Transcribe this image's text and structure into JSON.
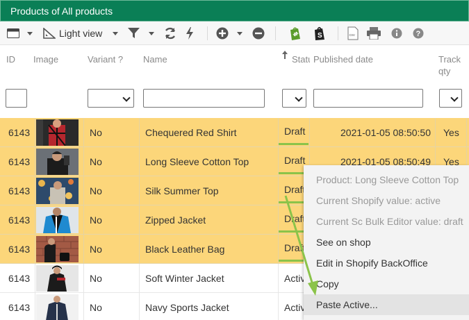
{
  "title": "Products of All products",
  "toolbar": {
    "view_label": "Light view"
  },
  "columns": {
    "id": "ID",
    "image": "Image",
    "variant": "Variant ?",
    "name": "Name",
    "status": "Statu",
    "published": "Published date",
    "track_line1": "Track",
    "track_line2": "qty"
  },
  "rows": [
    {
      "id": "6143",
      "variant": "No",
      "name": "Chequered Red Shirt",
      "status": "Draft",
      "published": "2021-01-05 08:50:50",
      "track": "Yes",
      "selected": true
    },
    {
      "id": "6143",
      "variant": "No",
      "name": "Long Sleeve Cotton Top",
      "status": "Draft",
      "published": "2021-01-05 08:50:49",
      "track": "Yes",
      "selected": true
    },
    {
      "id": "6143",
      "variant": "No",
      "name": "Silk Summer Top",
      "status": "Draft",
      "published": "",
      "track": "",
      "selected": true
    },
    {
      "id": "6143",
      "variant": "No",
      "name": "Zipped Jacket",
      "status": "Draft",
      "published": "",
      "track": "",
      "selected": true
    },
    {
      "id": "6143",
      "variant": "No",
      "name": "Black Leather Bag",
      "status": "Draft",
      "published": "",
      "track": "",
      "selected": true
    },
    {
      "id": "6143",
      "variant": "No",
      "name": "Soft Winter Jacket",
      "status": "Active",
      "published": "",
      "track": "",
      "selected": false
    },
    {
      "id": "6143",
      "variant": "No",
      "name": "Navy Sports Jacket",
      "status": "Active",
      "published": "",
      "track": "",
      "selected": false
    }
  ],
  "context_menu": {
    "items": [
      {
        "label": "Product: Long Sleeve Cotton Top",
        "disabled": true
      },
      {
        "label": "Current Shopify value: active",
        "disabled": true
      },
      {
        "label": "Current Sc Bulk Editor value: draft",
        "disabled": true
      },
      {
        "label": "See on shop",
        "disabled": false
      },
      {
        "label": "Edit in Shopify BackOffice",
        "disabled": false
      },
      {
        "label": "Copy",
        "disabled": false
      },
      {
        "label": "Paste Active...",
        "disabled": false
      }
    ]
  },
  "colors": {
    "header_green": "#0a7f56",
    "selected_row": "#fcd67a",
    "status_green": "#8bc34a",
    "arrow_green": "#8bc34a"
  }
}
